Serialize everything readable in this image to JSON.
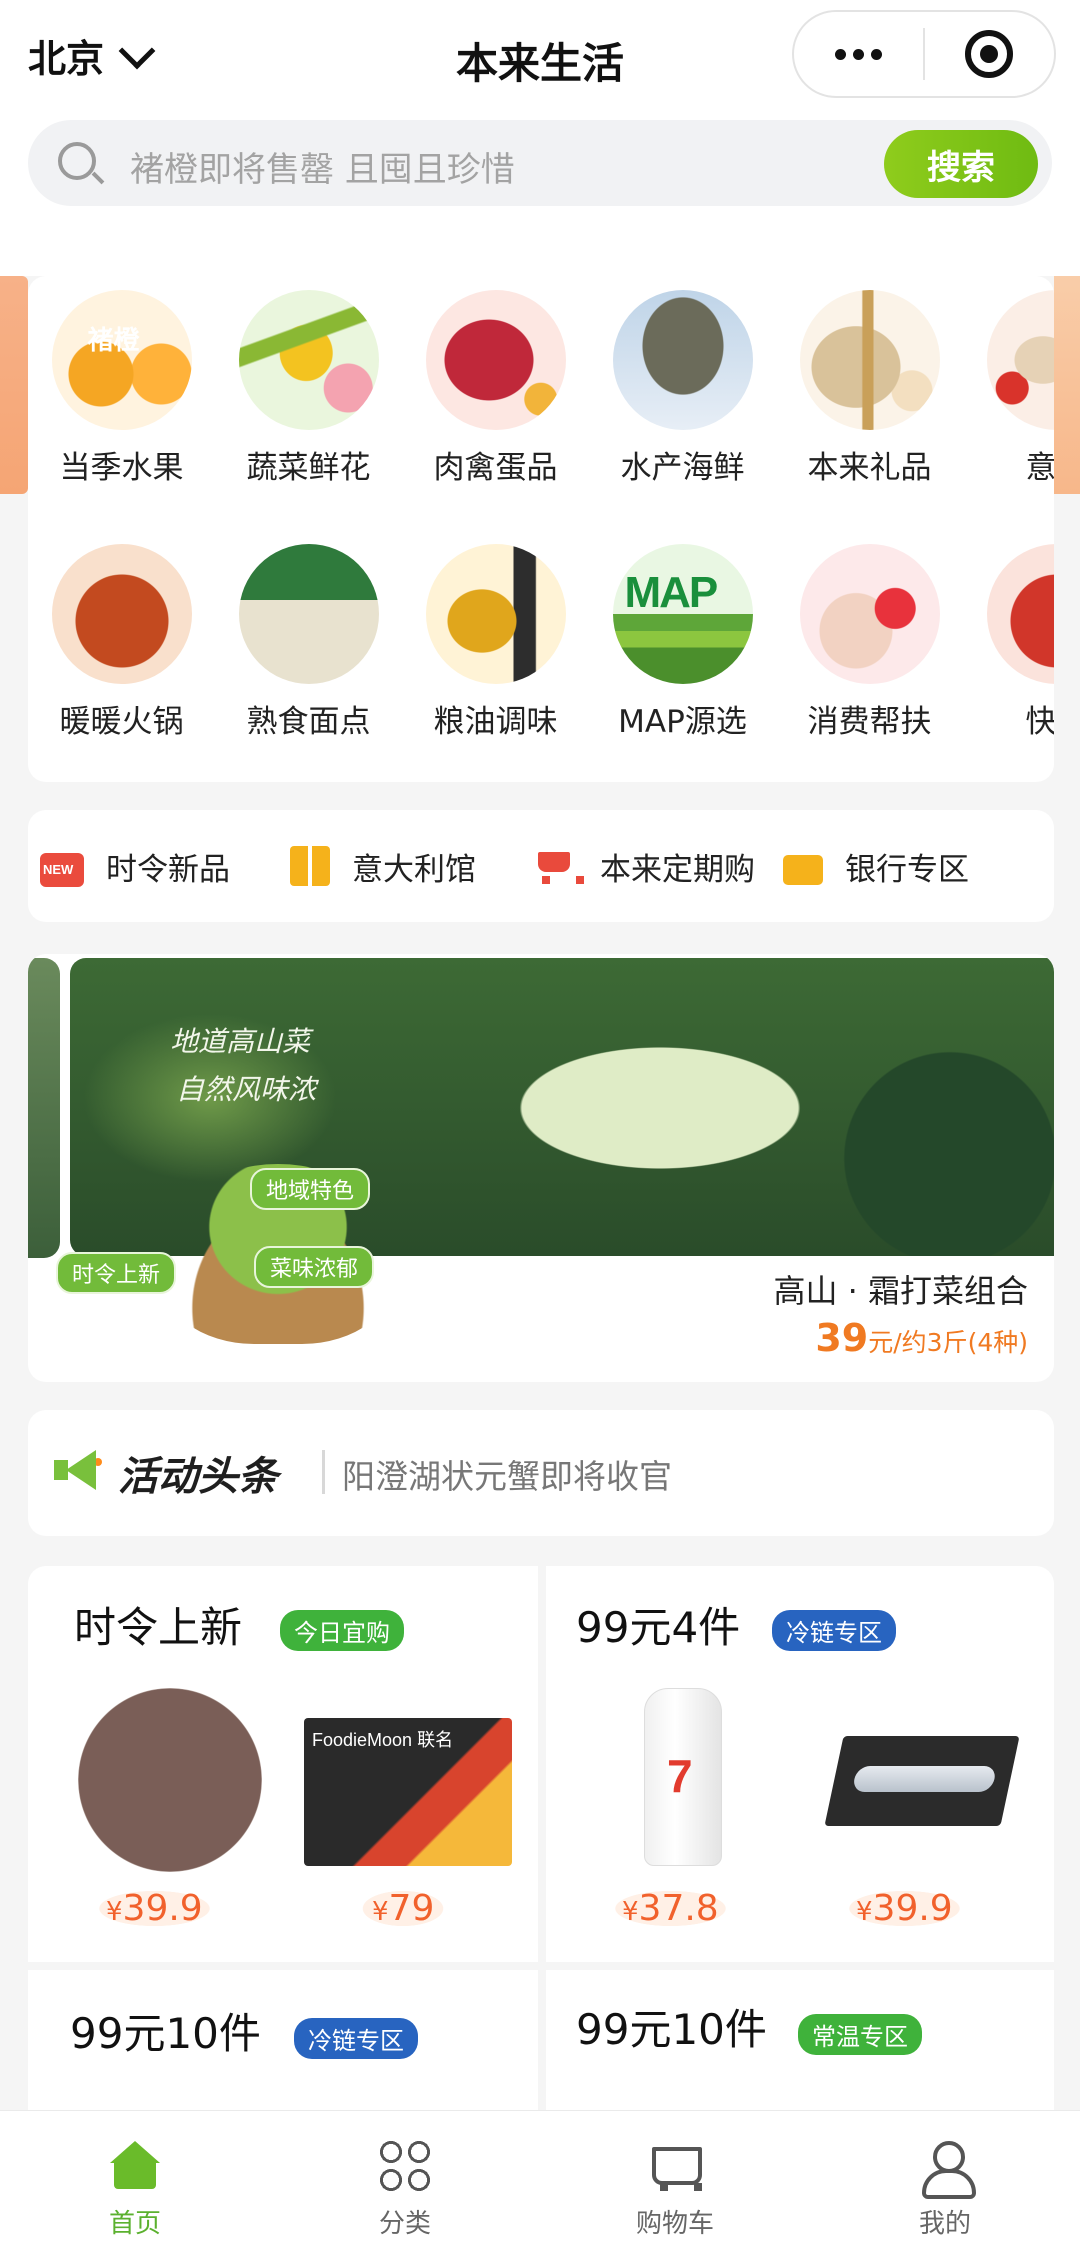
{
  "header": {
    "city": "北京",
    "title": "本来生活"
  },
  "search": {
    "placeholder": "褚橙即将售罄 且囤且珍惜",
    "button": "搜索"
  },
  "categories_row1": [
    {
      "label": "当季水果",
      "icon": "fruit-icon"
    },
    {
      "label": "蔬菜鲜花",
      "icon": "vegetable-flower-icon"
    },
    {
      "label": "肉禽蛋品",
      "icon": "meat-egg-icon"
    },
    {
      "label": "水产海鲜",
      "icon": "seafood-icon"
    },
    {
      "label": "本来礼品",
      "icon": "gift-icon"
    },
    {
      "label": "意大",
      "icon": "italy-icon"
    }
  ],
  "categories_row2": [
    {
      "label": "暖暖火锅",
      "icon": "hotpot-icon"
    },
    {
      "label": "熟食面点",
      "icon": "cooked-food-icon"
    },
    {
      "label": "粮油调味",
      "icon": "grain-oil-icon"
    },
    {
      "label": "MAP源选",
      "icon": "map-icon"
    },
    {
      "label": "消费帮扶",
      "icon": "charity-icon"
    },
    {
      "label": "快手",
      "icon": "quick-meal-icon"
    }
  ],
  "category_art_text": {
    "fruit_sign": "褚橙",
    "map_logo": "MAP"
  },
  "quick_links": [
    {
      "label": "时令新品",
      "icon": "new-badge-icon"
    },
    {
      "label": "意大利馆",
      "icon": "building-icon"
    },
    {
      "label": "本来定期购",
      "icon": "cart-icon"
    },
    {
      "label": "银行专区",
      "icon": "bank-card-icon"
    }
  ],
  "banner": {
    "slogan_line1": "地道高山菜",
    "slogan_line2": "自然风味浓",
    "tag1": "地域特色",
    "tag2": "时令上新",
    "tag3": "菜味浓郁",
    "product_name": "高山 · 霜打菜组合",
    "price": "39",
    "price_unit": "元/约3斤(4种)"
  },
  "news": {
    "label": "活动头条",
    "headline": "阳澄湖状元蟹即将收官"
  },
  "promos": [
    {
      "title": "时令上新",
      "badge": "今日宜购",
      "badge_color": "#3fb23b",
      "box_brand": "FoodieMoon 联名",
      "prices": [
        "39.9",
        "79"
      ]
    },
    {
      "title": "99元4件",
      "badge": "冷链专区",
      "badge_color": "#2864c0",
      "prices": [
        "37.8",
        "39.9"
      ]
    },
    {
      "title": "99元10件",
      "badge": "冷链专区",
      "badge_color": "#2864c0"
    },
    {
      "title": "99元10件",
      "badge": "常温专区",
      "badge_color": "#3fb23b"
    }
  ],
  "currency_symbol": "¥",
  "tabbar": [
    {
      "label": "首页",
      "icon": "home-icon",
      "active": true
    },
    {
      "label": "分类",
      "icon": "category-grid-icon",
      "active": false
    },
    {
      "label": "购物车",
      "icon": "cart-icon",
      "active": false
    },
    {
      "label": "我的",
      "icon": "profile-icon",
      "active": false
    }
  ],
  "colors": {
    "brand_green": "#6fbb12",
    "price_orange": "#f1612c",
    "badge_green": "#3fb23b",
    "badge_blue": "#2864c0"
  }
}
